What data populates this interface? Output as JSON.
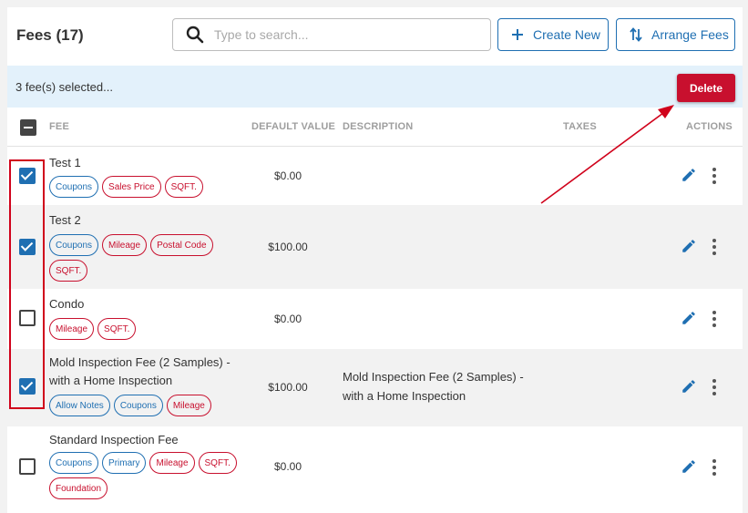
{
  "header": {
    "title": "Fees (17)",
    "search_placeholder": "Type to search...",
    "create_label": "Create New",
    "arrange_label": "Arrange Fees"
  },
  "selection": {
    "text": "3 fee(s) selected...",
    "delete_label": "Delete"
  },
  "columns": {
    "fee": "FEE",
    "default_value": "DEFAULT VALUE",
    "description": "DESCRIPTION",
    "taxes": "TAXES",
    "actions": "ACTIONS"
  },
  "rows": [
    {
      "checked": true,
      "name": "Test 1",
      "tags": [
        {
          "label": "Coupons",
          "color": "blue"
        },
        {
          "label": "Sales Price",
          "color": "red"
        },
        {
          "label": "SQFT.",
          "color": "red"
        }
      ],
      "value": "$0.00",
      "description": ""
    },
    {
      "checked": true,
      "name": "Test 2",
      "tags": [
        {
          "label": "Coupons",
          "color": "blue"
        },
        {
          "label": "Mileage",
          "color": "red"
        },
        {
          "label": "Postal Code",
          "color": "red"
        },
        {
          "label": "SQFT.",
          "color": "red"
        }
      ],
      "value": "$100.00",
      "description": ""
    },
    {
      "checked": false,
      "name": "Condo",
      "tags": [
        {
          "label": "Mileage",
          "color": "red"
        },
        {
          "label": "SQFT.",
          "color": "red"
        }
      ],
      "value": "$0.00",
      "description": ""
    },
    {
      "checked": true,
      "name": "Mold Inspection Fee (2 Samples) - with a Home Inspection",
      "tags": [
        {
          "label": "Allow Notes",
          "color": "blue"
        },
        {
          "label": "Coupons",
          "color": "blue"
        },
        {
          "label": "Mileage",
          "color": "red"
        }
      ],
      "value": "$100.00",
      "description": "Mold Inspection Fee (2 Samples) - with a Home Inspection"
    },
    {
      "checked": false,
      "name": "Standard Inspection Fee",
      "tags": [
        {
          "label": "Coupons",
          "color": "blue"
        },
        {
          "label": "Primary",
          "color": "blue"
        },
        {
          "label": "Mileage",
          "color": "red"
        },
        {
          "label": "SQFT.",
          "color": "red"
        },
        {
          "label": "Foundation",
          "color": "red"
        }
      ],
      "value": "$0.00",
      "description": ""
    }
  ],
  "colors": {
    "primary": "#1f6fb2",
    "danger": "#c8102e",
    "selection_bar": "#e3f1fb",
    "annotation": "#d0021b"
  },
  "icons": {
    "search": "search-icon",
    "create": "plus-icon",
    "arrange": "sort-arrows-icon",
    "edit": "pencil-icon",
    "more": "more-vertical-icon"
  }
}
